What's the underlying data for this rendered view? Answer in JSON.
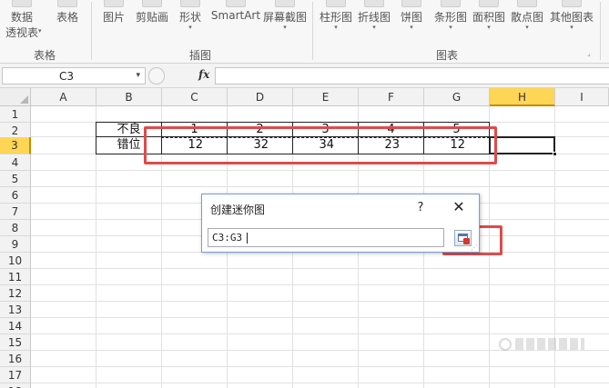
{
  "ribbon": {
    "buttons": [
      {
        "label": "数据",
        "sub": "透视表",
        "arrow": "▾"
      },
      {
        "label": "表格"
      },
      {
        "label": "图片"
      },
      {
        "label": "剪贴画"
      },
      {
        "label": "形状",
        "arrow": "▾"
      },
      {
        "label": "SmartArt"
      },
      {
        "label": "屏幕截图",
        "arrow": "▾"
      },
      {
        "label": "柱形图",
        "arrow": "▾"
      },
      {
        "label": "折线图",
        "arrow": "▾"
      },
      {
        "label": "饼图",
        "arrow": "▾"
      },
      {
        "label": "条形图",
        "arrow": "▾"
      },
      {
        "label": "面积图",
        "arrow": "▾"
      },
      {
        "label": "散点图",
        "arrow": "▾"
      },
      {
        "label": "其他图表",
        "arrow": "▾"
      }
    ],
    "groups": [
      "表格",
      "插图",
      "图表"
    ],
    "launcher_icon": "dialog-launcher-icon"
  },
  "formula_bar": {
    "name_box": "C3",
    "name_box_dropdown": "▾",
    "fx": "fx",
    "formula": ""
  },
  "sheet": {
    "columns": [
      "A",
      "B",
      "C",
      "D",
      "E",
      "F",
      "G",
      "H",
      "I"
    ],
    "rows": [
      "1",
      "2",
      "3",
      "4",
      "5",
      "6",
      "7",
      "8",
      "9",
      "10",
      "11",
      "12",
      "13",
      "14",
      "15",
      "16",
      "17",
      "18"
    ],
    "selected_column": "H",
    "selected_row": "3",
    "row2": {
      "label": "不良",
      "values": [
        "1",
        "2",
        "3",
        "4",
        "5"
      ]
    },
    "row3": {
      "label": "错位",
      "values": [
        "12",
        "32",
        "34",
        "23",
        "12"
      ]
    }
  },
  "dialog": {
    "title": "创建迷你图",
    "help": "?",
    "close": "✕",
    "range_value": "C3:G3",
    "collapse_icon": "collapse-dialog-icon",
    "grip": "⋰"
  },
  "colors": {
    "highlight_red": "#e04a4a",
    "selected_header": "#ffd556"
  }
}
